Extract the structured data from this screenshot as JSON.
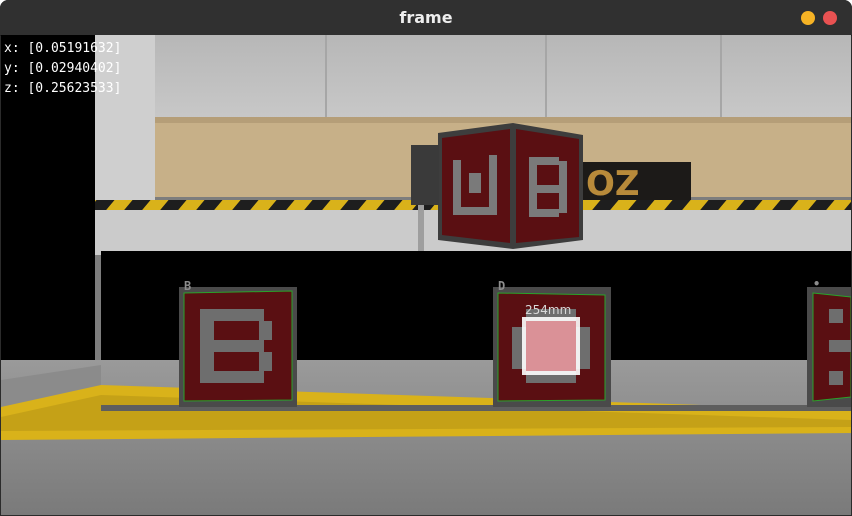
{
  "window": {
    "title": "frame",
    "controls": {
      "minimize_color": "#f6b325",
      "close_color": "#e95252"
    }
  },
  "readout": {
    "x": "x: [0.05191632]",
    "y": "y: [0.02940402]",
    "z": "z: [0.25623533]"
  },
  "markers": [
    {
      "label": "B",
      "icon": "aruco-marker-b"
    },
    {
      "label": "D",
      "distance": "254mm",
      "icon": "aruco-marker-d"
    },
    {
      "label": "•",
      "icon": "aruco-marker-partial"
    }
  ],
  "colors": {
    "marker_fill": "#5a0f12",
    "marker_border": "#4a4a4a",
    "detection_outline": "#2aa32a",
    "hazard_yellow": "#d9b21a",
    "highlight": "#e8a0a6"
  }
}
